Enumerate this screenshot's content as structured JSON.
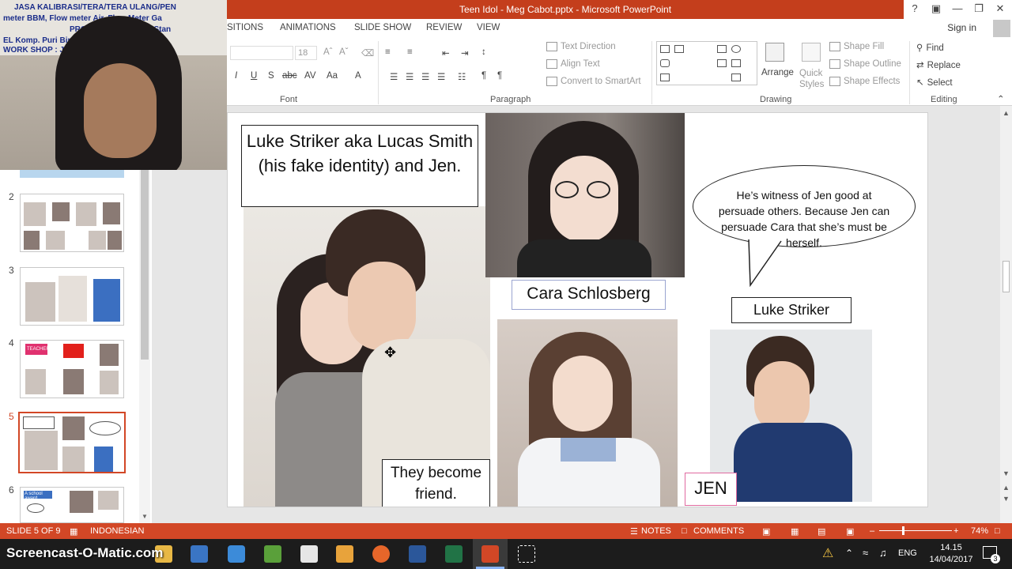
{
  "window": {
    "title": "Teen Idol - Meg Cabot.pptx - Microsoft PowerPoint",
    "help": "?",
    "minimize": "—",
    "restore": "❐",
    "close": "✕"
  },
  "ribbon": {
    "tabs": [
      "SITIONS",
      "ANIMATIONS",
      "SLIDE SHOW",
      "REVIEW",
      "VIEW"
    ],
    "signin": "Sign in",
    "font": {
      "size": "18",
      "group_label": "Font",
      "buttons": [
        "I",
        "U",
        "S",
        "abc",
        "AV",
        "Aa",
        "A"
      ]
    },
    "paragraph": {
      "group_label": "Paragraph",
      "text_direction": "Text Direction",
      "align_text": "Align Text",
      "convert_smartart": "Convert to SmartArt"
    },
    "drawing": {
      "group_label": "Drawing",
      "arrange": "Arrange",
      "quick_styles": "Quick\nStyles",
      "shape_fill": "Shape Fill",
      "shape_outline": "Shape Outline",
      "shape_effects": "Shape Effects"
    },
    "editing": {
      "group_label": "Editing",
      "find": "Find",
      "replace": "Replace",
      "select": "Select"
    }
  },
  "webcam": {
    "banner_lines": [
      "JASA KALIBRASI/TERA/TERA ULANG/PEN",
      "meter BBM, Flow meter Air, Flow Meter Ga",
      "PRODUKSI Tank Ukur Stan",
      "EL Komp. Puri Bintaro ... B No 16",
      "WORK SHOP : Jl. KI ... No 15 Neigh"
    ]
  },
  "thumbnails": {
    "numbers": [
      "2",
      "3",
      "4",
      "5",
      "6"
    ],
    "mini_texts": [
      "TEACHER",
      "A school award"
    ]
  },
  "slide": {
    "title_box": "Luke Striker aka Lucas Smith (his fake identity) and Jen.",
    "friend_box": "They become friend.",
    "cara_label": "Cara Schlosberg",
    "bubble": "He’s witness of Jen good at persuade others. Because Jen can persuade Cara that she’s must be herself.",
    "luke_label": "Luke Striker",
    "jen_label": "JEN"
  },
  "status": {
    "slide": "SLIDE 5 OF 9",
    "language": "INDONESIAN",
    "notes": "NOTES",
    "comments": "COMMENTS",
    "zoom": "74%"
  },
  "taskbar": {
    "watermark": "Screencast-O-Matic.com",
    "lang": "ENG",
    "time": "14.15",
    "date": "14/04/2017",
    "notif_count": "3"
  },
  "colors": {
    "accent": "#d24726",
    "titlebar": "#c43e1c",
    "taskbar": "#1c1c1c"
  }
}
